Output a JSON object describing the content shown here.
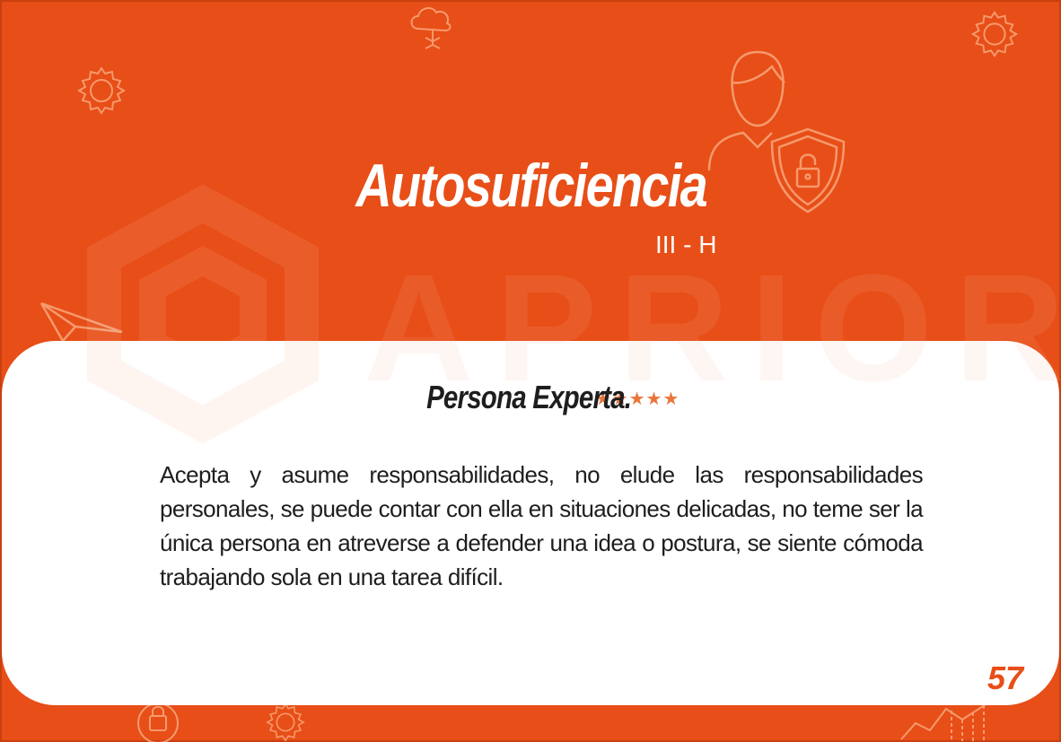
{
  "card": {
    "title": "Autosuficiencia",
    "code": "III - H",
    "watermark": "APRIORI",
    "level": {
      "label": "Persona Experta.",
      "stars_text": "★★★★★",
      "rating": 5,
      "rating_max": 5
    },
    "description": "Acepta y asume responsabilidades, no elude las responsabilidades personales, se puede contar con ella en situaciones delicadas, no teme ser la única persona en atreverse a defender una idea o postura, se siente cómoda trabajando sola en una tarea difícil.",
    "page_number": "57"
  },
  "colors": {
    "background": "#e84e17",
    "panel": "#ffffff",
    "star": "#e8753a",
    "text": "#1e1e1e"
  },
  "icons": [
    "cloud-network-icon",
    "gear-icon",
    "user-icon",
    "shield-lock-icon",
    "paper-plane-icon",
    "lock-icon",
    "chart-icon"
  ]
}
